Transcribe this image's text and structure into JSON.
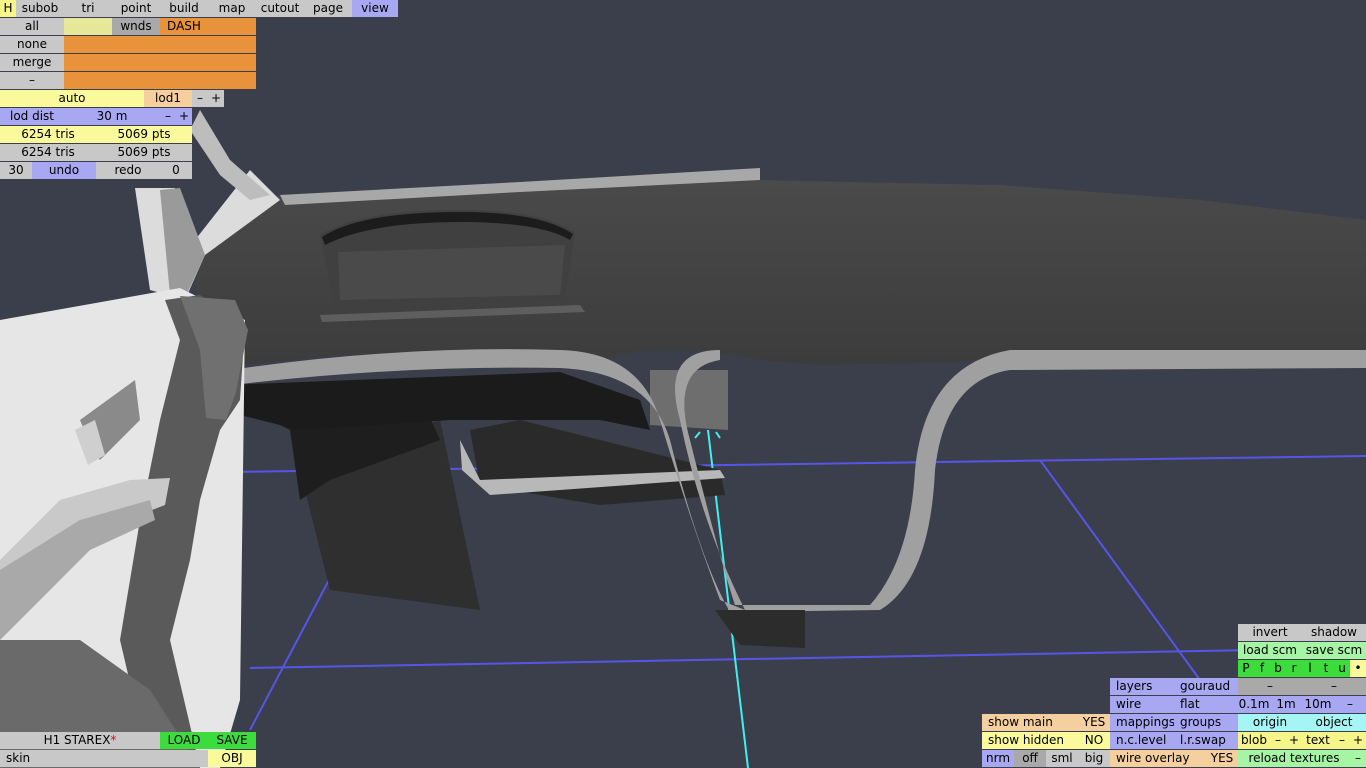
{
  "top_menu": {
    "h": "H",
    "items": [
      "subob",
      "tri",
      "point",
      "build",
      "map",
      "cutout",
      "page",
      "view"
    ]
  },
  "select": {
    "all": "all",
    "none": "none",
    "merge": "merge",
    "dash": "–",
    "wnds": "wnds",
    "dash_label": "DASH"
  },
  "lod": {
    "auto": "auto",
    "level": "lod1",
    "minus": "–",
    "plus": "+",
    "dist_label": "lod dist",
    "dist_value": "30 m",
    "stats": [
      {
        "tris": "6254 tris",
        "pts": "5069 pts"
      },
      {
        "tris": "6254 tris",
        "pts": "5069 pts"
      }
    ],
    "undo_count": "30",
    "undo": "undo",
    "redo": "redo",
    "redo_count": "0"
  },
  "file": {
    "name": "H1 STAREX",
    "modified": "*",
    "load": "LOAD",
    "save": "SAVE",
    "skin": "skin",
    "obj": "OBJ"
  },
  "show": {
    "main": "show main",
    "main_val": "YES",
    "hidden": "show hidden",
    "hidden_val": "NO",
    "nrm": "nrm",
    "off": "off",
    "sml": "sml",
    "big": "big"
  },
  "render": {
    "layers": "layers",
    "gouraud": "gouraud",
    "wire": "wire",
    "flat": "flat",
    "mappings": "mappings",
    "groups": "groups",
    "nclevel": "n.c.level",
    "lrswap": "l.r.swap",
    "wire_overlay": "wire overlay",
    "wire_overlay_val": "YES"
  },
  "right": {
    "invert": "invert",
    "shadow": "shadow",
    "load_scm": "load scm",
    "save_scm": "save scm",
    "flags": [
      "P",
      "f",
      "b",
      "r",
      "l",
      "t",
      "u",
      "•"
    ],
    "minus": "–",
    "grid": [
      "0.1m",
      "1m",
      "10m",
      "–"
    ],
    "origin": "origin",
    "object": "object",
    "blob": "blob",
    "text": "text",
    "plus": "+",
    "reload": "reload textures"
  },
  "colors": {
    "background": "#3b3e4b",
    "grid_line": "#4f4fe0",
    "axis": "#40f0f0"
  }
}
